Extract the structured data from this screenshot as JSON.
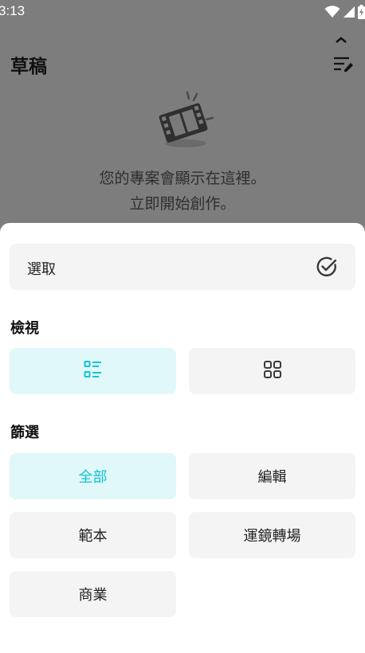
{
  "status_bar": {
    "time": "3:13",
    "icons": [
      "wifi-icon",
      "signal-icon",
      "battery-charging-icon"
    ]
  },
  "page": {
    "title": "草稿",
    "empty_state": {
      "icon": "film-clapper-icon",
      "line1": "您的專案會顯示在這裡。",
      "line2": "立即開始創作。"
    }
  },
  "sheet": {
    "select": {
      "label": "選取",
      "icon": "check-circle-icon"
    },
    "view": {
      "title": "檢視",
      "options": [
        {
          "icon": "list-view-icon",
          "selected": true
        },
        {
          "icon": "grid-view-icon",
          "selected": false
        }
      ]
    },
    "filter": {
      "title": "篩選",
      "options": [
        {
          "label": "全部",
          "selected": true
        },
        {
          "label": "編輯",
          "selected": false
        },
        {
          "label": "範本",
          "selected": false
        },
        {
          "label": "運鏡轉場",
          "selected": false
        },
        {
          "label": "商業",
          "selected": false
        }
      ]
    }
  },
  "colors": {
    "accent": "#12c4d4",
    "accent_bg": "#e0f8fa",
    "tile_bg": "#f4f4f4",
    "scrim": "#7d7d7d"
  }
}
